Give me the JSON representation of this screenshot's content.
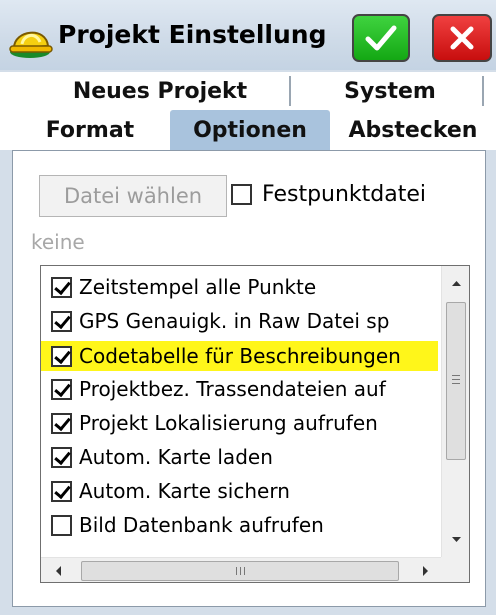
{
  "window": {
    "title": "Projekt Einstellung",
    "ok_icon": "checkmark-icon",
    "cancel_icon": "close-icon",
    "app_icon": "hardhat-icon"
  },
  "tabs": {
    "row1": [
      {
        "label": "Neues Projekt"
      },
      {
        "label": "System"
      }
    ],
    "row2": [
      {
        "label": "Format"
      },
      {
        "label": "Optionen",
        "active": true
      },
      {
        "label": "Abstecken"
      }
    ]
  },
  "file": {
    "choose_button": "Datei wählen",
    "fixed_point_label": "Festpunktdatei",
    "fixed_point_checked": false,
    "current_file": "keine"
  },
  "options": [
    {
      "label": "Zeitstempel alle Punkte",
      "checked": true
    },
    {
      "label": "GPS Genauigk. in Raw Datei sp",
      "checked": true
    },
    {
      "label": "Codetabelle für Beschreibungen",
      "checked": true,
      "highlighted": true
    },
    {
      "label": "Projektbez. Trassendateien auf",
      "checked": true
    },
    {
      "label": "Projekt Lokalisierung aufrufen",
      "checked": true
    },
    {
      "label": "Autom. Karte laden",
      "checked": true
    },
    {
      "label": "Autom. Karte sichern",
      "checked": true
    },
    {
      "label": "Bild Datenbank aufrufen",
      "checked": false
    }
  ],
  "colors": {
    "highlight": "#fff61a",
    "active_tab": "#a9c3dd",
    "ok_green": "#14a814",
    "cancel_red": "#c80e0e"
  }
}
